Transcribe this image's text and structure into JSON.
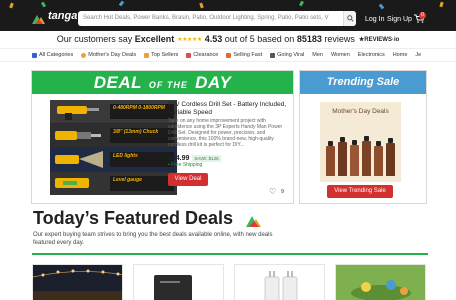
{
  "header": {
    "logo_text": "tanga",
    "search_placeholder": "Search Hot Deals, Power Banks, Brasin, Patio, Outdoor Lighting, Spring, Patio, Patio sets, V",
    "login_label": "Log In",
    "signup_label": "Sign Up",
    "cart_count": "0",
    "icons": [
      "search-icon",
      "cart-icon"
    ]
  },
  "reviews_bar": {
    "prefix": "Our customers say",
    "rating_word": "Excellent",
    "score": "4.53",
    "middle": "out of 5 based on",
    "count": "85183",
    "suffix": "reviews",
    "provider": "★REVIEWS·io"
  },
  "category_nav": {
    "items": [
      {
        "label": "All Categories",
        "icon": "grid-icon",
        "color": "#3b5bdb"
      },
      {
        "label": "Mother's Day Deals",
        "icon": "flower-icon",
        "color": "#e8a33c"
      },
      {
        "label": "Top Sellers",
        "icon": "trophy-icon",
        "color": "#e8a33c"
      },
      {
        "label": "Clearance",
        "icon": "tag-icon",
        "color": "#d94f4f"
      },
      {
        "label": "Selling Fast",
        "icon": "rocket-icon",
        "color": "#e26a2c"
      },
      {
        "label": "Going Viral",
        "icon": "chart-icon",
        "color": "#555555"
      },
      {
        "label": "Men",
        "icon": "",
        "color": ""
      },
      {
        "label": "Women",
        "icon": "",
        "color": ""
      },
      {
        "label": "Electronics",
        "icon": "",
        "color": ""
      },
      {
        "label": "Home",
        "icon": "",
        "color": ""
      },
      {
        "label": "Je",
        "icon": "",
        "color": ""
      }
    ]
  },
  "deal_of_day": {
    "banner_left": "DEAL",
    "banner_mid": "OF THE",
    "banner_right": "DAY",
    "accent": "#24b34b",
    "image_labels": [
      "0-480RPM 0-1800RPM",
      "3/8\" (13mm) Chuck",
      "LED lights",
      "Level gauge"
    ],
    "title": "21V Cordless Drill Set - Battery Included, Variable Speed",
    "description": "Take on any home improvement project with confidence using the 3P Experts Handy Man Power Drill Set. Designed for power, precision, and convenience, this 100% brand-new, high-quality cordless drill kit is perfect for DIY...",
    "price": "$24.99",
    "save_badge": "SAVE: $125",
    "shipping": "Free Shipping",
    "button_label": "View Deal",
    "likes": "9"
  },
  "trending_sale": {
    "banner": "Trending Sale",
    "accent": "#4a9bd1",
    "image_caption": "Mother's Day Deals",
    "button_label": "View Trending Sale"
  },
  "featured": {
    "title": "Today’s Featured Deals",
    "subtitle": "Our expert buying team strives to bring you the best deals available online, with new deals featured every day."
  }
}
